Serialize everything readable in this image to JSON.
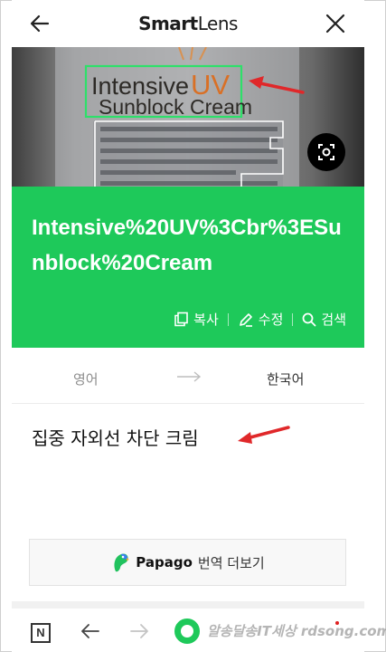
{
  "header": {
    "brand_part1": "Smart",
    "brand_part2": "Lens"
  },
  "photo": {
    "label_line1_a": "Intensive",
    "label_line1_b": "UV",
    "label_line2": "Sunblock Cream"
  },
  "result": {
    "recognized_text": "Intensive%20UV%3Cbr%3ESunblock%20Cream",
    "copy_label": "복사",
    "edit_label": "수정",
    "search_label": "검색"
  },
  "language": {
    "source": "영어",
    "target": "한국어"
  },
  "translation": {
    "text": "집중 자외선 차단 크림"
  },
  "papago": {
    "name": "Papago",
    "more_label": "번역 더보기"
  },
  "nav": {
    "home_letter": "N"
  },
  "watermark": {
    "text": "알송달송IT세상 rdsong.com"
  },
  "colors": {
    "accent_green": "#1ec95a",
    "annotation_red": "#e0282a"
  }
}
